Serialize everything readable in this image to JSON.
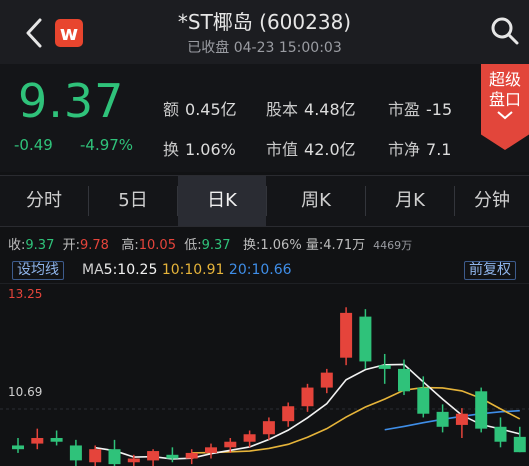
{
  "header": {
    "title": "*ST椰岛 (600238)",
    "status": "已收盘 04-23 15:00:03",
    "logo_text": "w"
  },
  "quote": {
    "price": "9.37",
    "change": "-0.49",
    "change_pct": "-4.97%",
    "fields": [
      {
        "k": "额",
        "v": "0.45亿"
      },
      {
        "k": "股本",
        "v": "4.48亿"
      },
      {
        "k": "市盈",
        "v": "-15"
      },
      {
        "k": "换",
        "v": "1.06%"
      },
      {
        "k": "市值",
        "v": "42.0亿"
      },
      {
        "k": "市净",
        "v": "7.1"
      }
    ],
    "ribbon": "超级盘口"
  },
  "tabs": [
    "分时",
    "5日",
    "日K",
    "周K",
    "月K",
    "分钟"
  ],
  "active_tab": "日K",
  "ohlc": {
    "close_label": "收:",
    "close": "9.37",
    "open_label": "开:",
    "open": "9.78",
    "high_label": "高:",
    "high": "10.05",
    "low_label": "低:",
    "low": "9.37",
    "turnover_label": "换:",
    "turnover": "1.06%",
    "volume_label": "量:",
    "volume": "4.71万",
    "extra": "4469万"
  },
  "ma_bar": {
    "set_button": "设均线",
    "ma_prefix": "MA",
    "ma5_label": "5:",
    "ma5": "10.25",
    "ma10_label": "10:",
    "ma10": "10.91",
    "ma20_label": "20:",
    "ma20": "10.66",
    "adjust_button": "前复权"
  },
  "colors": {
    "up": "#e5443b",
    "down": "#2fc27a",
    "ma5": "#f2f2f2",
    "ma10": "#e6b43a",
    "ma20": "#3f8ee8",
    "accent": "#e2463b"
  },
  "chart_data": {
    "type": "candlestick",
    "y_labels": [
      "13.25",
      "10.69"
    ],
    "ylim": [
      9.0,
      13.9
    ],
    "candles": [
      {
        "o": 9.55,
        "h": 9.75,
        "l": 9.35,
        "c": 9.45
      },
      {
        "o": 9.6,
        "h": 10.0,
        "l": 9.45,
        "c": 9.75
      },
      {
        "o": 9.75,
        "h": 9.95,
        "l": 9.55,
        "c": 9.65
      },
      {
        "o": 9.55,
        "h": 9.7,
        "l": 9.0,
        "c": 9.15
      },
      {
        "o": 9.1,
        "h": 9.55,
        "l": 8.95,
        "c": 9.45
      },
      {
        "o": 9.45,
        "h": 9.7,
        "l": 9.0,
        "c": 9.05
      },
      {
        "o": 9.1,
        "h": 9.3,
        "l": 8.9,
        "c": 9.2
      },
      {
        "o": 9.15,
        "h": 9.45,
        "l": 9.0,
        "c": 9.4
      },
      {
        "o": 9.3,
        "h": 9.5,
        "l": 9.1,
        "c": 9.2
      },
      {
        "o": 9.2,
        "h": 9.45,
        "l": 9.05,
        "c": 9.35
      },
      {
        "o": 9.35,
        "h": 9.6,
        "l": 9.2,
        "c": 9.5
      },
      {
        "o": 9.5,
        "h": 9.75,
        "l": 9.35,
        "c": 9.65
      },
      {
        "o": 9.65,
        "h": 9.95,
        "l": 9.5,
        "c": 9.85
      },
      {
        "o": 9.85,
        "h": 10.3,
        "l": 9.7,
        "c": 10.2
      },
      {
        "o": 10.2,
        "h": 10.7,
        "l": 10.05,
        "c": 10.6
      },
      {
        "o": 10.6,
        "h": 11.2,
        "l": 10.45,
        "c": 11.1
      },
      {
        "o": 11.1,
        "h": 11.6,
        "l": 10.95,
        "c": 11.5
      },
      {
        "o": 11.9,
        "h": 13.25,
        "l": 11.7,
        "c": 13.1
      },
      {
        "o": 13.0,
        "h": 13.2,
        "l": 11.6,
        "c": 11.8
      },
      {
        "o": 11.7,
        "h": 12.0,
        "l": 11.2,
        "c": 11.6
      },
      {
        "o": 11.6,
        "h": 11.85,
        "l": 10.9,
        "c": 11.0
      },
      {
        "o": 11.1,
        "h": 11.4,
        "l": 10.3,
        "c": 10.4
      },
      {
        "o": 10.45,
        "h": 10.65,
        "l": 9.9,
        "c": 10.05
      },
      {
        "o": 10.1,
        "h": 10.55,
        "l": 9.75,
        "c": 10.4
      },
      {
        "o": 11.0,
        "h": 11.1,
        "l": 9.9,
        "c": 10.0
      },
      {
        "o": 10.05,
        "h": 10.3,
        "l": 9.5,
        "c": 9.65
      },
      {
        "o": 9.78,
        "h": 10.05,
        "l": 9.37,
        "c": 9.37
      }
    ],
    "ma5": [
      null,
      null,
      null,
      null,
      9.49,
      9.41,
      9.24,
      9.25,
      9.19,
      9.21,
      9.33,
      9.42,
      9.51,
      9.71,
      9.96,
      10.29,
      10.67,
      11.31,
      11.58,
      11.71,
      11.72,
      11.25,
      10.79,
      10.36,
      10.11,
      9.99,
      9.86
    ],
    "ma10": [
      null,
      null,
      null,
      null,
      null,
      null,
      null,
      null,
      null,
      9.35,
      9.36,
      9.38,
      9.4,
      9.47,
      9.58,
      9.77,
      10.0,
      10.31,
      10.58,
      10.79,
      11.03,
      11.1,
      11.09,
      11.01,
      10.81,
      10.53,
      10.26
    ],
    "ma20": [
      null,
      null,
      null,
      null,
      null,
      null,
      null,
      null,
      null,
      null,
      null,
      null,
      null,
      null,
      null,
      null,
      null,
      null,
      null,
      9.97,
      10.06,
      10.16,
      10.25,
      10.33,
      10.4,
      10.45,
      10.48
    ]
  }
}
